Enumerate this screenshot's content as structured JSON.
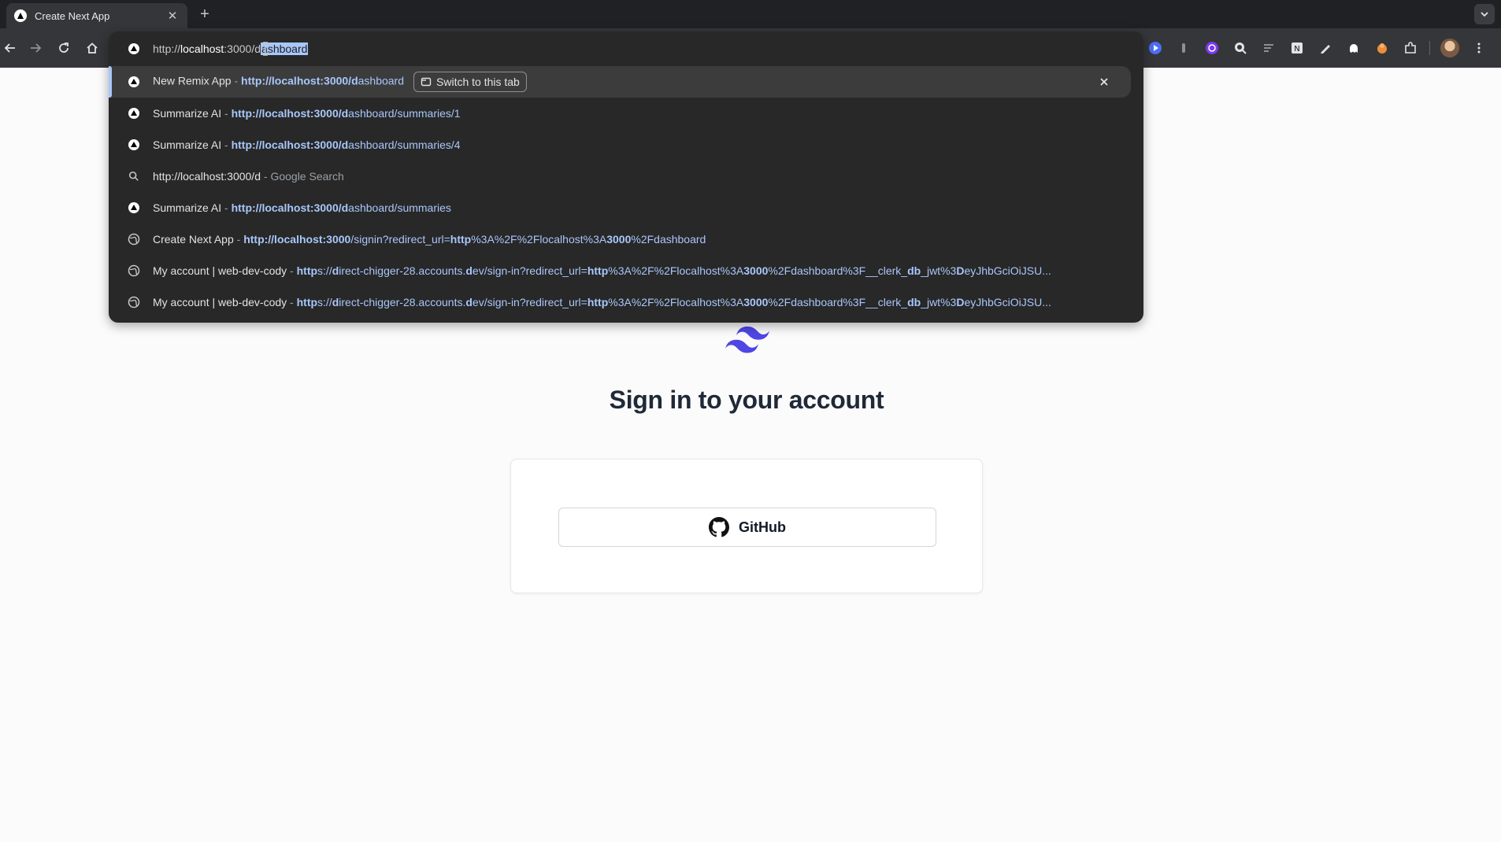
{
  "browser": {
    "tab": {
      "title": "Create Next App"
    },
    "icons": {
      "back": "back-arrow-icon",
      "forward": "forward-arrow-icon",
      "reload": "reload-icon",
      "home": "home-icon",
      "new_tab": "plus-icon",
      "close": "close-icon"
    }
  },
  "omnibox": {
    "input_prefix": "http://",
    "input_host": "localhost",
    "input_mid": ":3000",
    "input_slash": "/d",
    "input_selected": "ashboard",
    "suggestions": [
      {
        "icon": "vercel-triangle-icon",
        "title": "New Remix App",
        "separator": " - ",
        "url_bold": "http://localhost:3000/d",
        "url_rest": "ashboard",
        "action": "Switch to this tab"
      },
      {
        "icon": "vercel-triangle-icon",
        "title": "Summarize AI",
        "separator": " - ",
        "url_bold": "http://localhost:3000/d",
        "url_rest": "ashboard/summaries/1"
      },
      {
        "icon": "vercel-triangle-icon",
        "title": "Summarize AI",
        "separator": " - ",
        "url_bold": "http://localhost:3000/d",
        "url_rest": "ashboard/summaries/4"
      },
      {
        "icon": "search-icon",
        "title": "http://localhost:3000/d",
        "separator": " - ",
        "suffix": "Google Search"
      },
      {
        "icon": "vercel-triangle-icon",
        "title": "Summarize AI",
        "separator": " - ",
        "url_bold": "http://localhost:3000/d",
        "url_rest": "ashboard/summaries"
      },
      {
        "icon": "globe-icon",
        "title": "Create Next App",
        "separator": " - ",
        "url_html_parts": [
          "http://localhost:3000",
          "/signin?redirect_url=",
          "http",
          "%3A%2F%2Flocalhost%3A",
          "3000",
          "%2Fdashboard"
        ]
      },
      {
        "icon": "globe-icon",
        "title": "My account | web-dev-cody",
        "separator": " - ",
        "url_parts": [
          "http",
          "s://",
          "d",
          "irect-chigger-28.accounts.",
          "d",
          "ev/sign-in?redirect_url=",
          "http",
          "%3A%2F%2Flocalhost%3A",
          "3000",
          "%2Fdashboard%3F__clerk_",
          "db",
          "_jwt%3",
          "D",
          "eyJhbGciOiJSU..."
        ]
      },
      {
        "icon": "globe-icon",
        "title": "My account | web-dev-cody",
        "separator": " - ",
        "url_parts": [
          "http",
          "s://",
          "d",
          "irect-chigger-28.accounts.",
          "d",
          "ev/sign-in?redirect_url=",
          "http",
          "%3A%2F%2Flocalhost%3A",
          "3000",
          "%2Fdashboard%3F__clerk_",
          "db",
          "_jwt%3",
          "D",
          "eyJhbGciOiJSU..."
        ]
      }
    ]
  },
  "page": {
    "title": "Sign in to your account",
    "github_button": "GitHub",
    "logo": "tailwind-logo-icon",
    "brand_color": "#4f46e5"
  }
}
